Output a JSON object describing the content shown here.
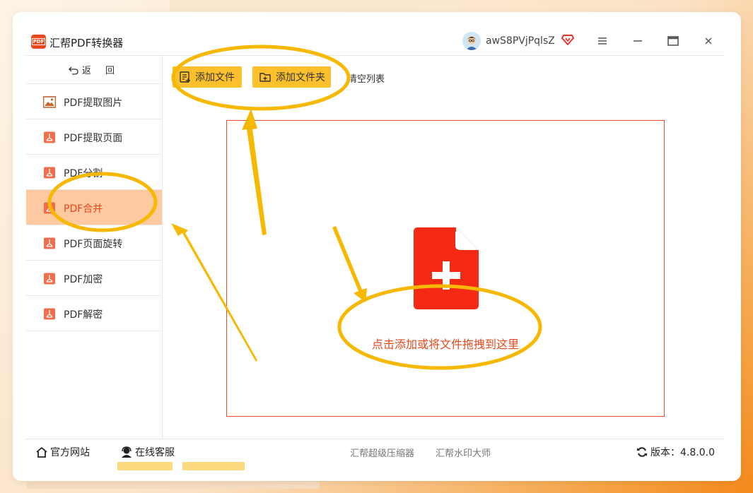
{
  "app": {
    "title": "汇帮PDF转换器",
    "logo_text": "PDF",
    "username": "awS8PVjPqlsZ"
  },
  "icons": {
    "logo": "pdf-logo-icon",
    "vip": "vip-diamond-icon",
    "menu": "hamburger-menu-icon",
    "minimize": "minimize-icon",
    "maximize": "maximize-icon",
    "close": "close-icon",
    "back": "back-arrow-icon",
    "image_tool": "image-icon",
    "pdf_tool": "pdf-file-icon",
    "add_file": "add-file-icon",
    "add_folder": "add-folder-icon",
    "drop": "file-plus-icon",
    "home": "home-icon",
    "service": "customer-service-icon",
    "refresh": "refresh-icon"
  },
  "sidebar": {
    "back_label": "返 回",
    "items": [
      {
        "label": "PDF提取图片"
      },
      {
        "label": "PDF提取页面"
      },
      {
        "label": "PDF分割"
      },
      {
        "label": "PDF合并"
      },
      {
        "label": "PDF页面旋转"
      },
      {
        "label": "PDF加密"
      },
      {
        "label": "PDF解密"
      }
    ],
    "active_index": 3
  },
  "toolbar": {
    "add_file_label": "添加文件",
    "add_folder_label": "添加文件夹",
    "clear_list_label": "清空列表"
  },
  "dropzone": {
    "text": "点击添加或将文件拖拽到这里"
  },
  "footer": {
    "official_site": "官方网站",
    "online_service": "在线客服",
    "compressor_link": "汇帮超级压缩器",
    "watermark_link": "汇帮水印大师",
    "version_label": "版本：4.8.0.0"
  },
  "colors": {
    "accent": "#e9471c",
    "button": "#fcc02c",
    "active_bg": "#fdc9a1",
    "annotation": "#f6b800"
  }
}
